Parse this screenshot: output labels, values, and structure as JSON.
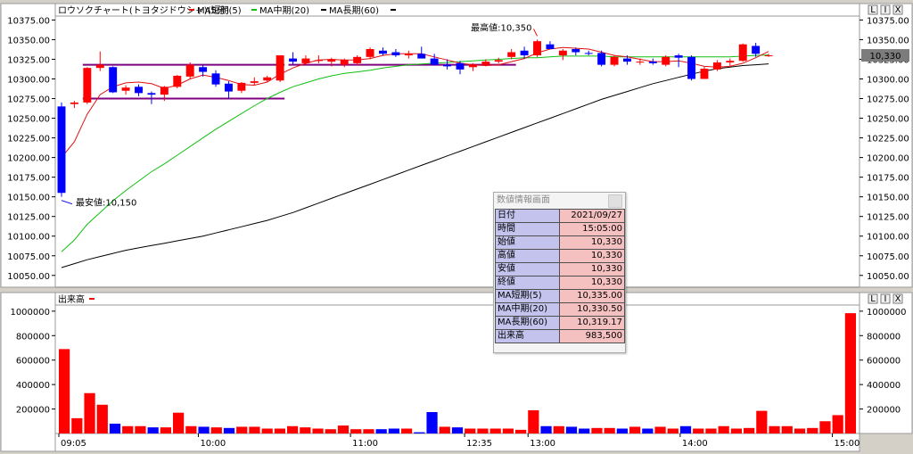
{
  "chart_data": [
    {
      "type": "candlestick",
      "title": "ロウソクチャート(トヨタジドウシャ)(5分)",
      "legend": [
        {
          "name": "MA短期(5)",
          "color": "#e01010"
        },
        {
          "name": "MA中期(20)",
          "color": "#10c010"
        },
        {
          "name": "MA長期(60)",
          "color": "#000000"
        }
      ],
      "ylim": [
        10035,
        10380
      ],
      "yticks": [
        10050,
        10075,
        10100,
        10125,
        10150,
        10175,
        10200,
        10225,
        10250,
        10275,
        10300,
        10325,
        10350,
        10375
      ],
      "ytick_labels": [
        "10050.00",
        "10075.00",
        "10100.00",
        "10125.00",
        "10150.00",
        "10175.00",
        "10200.00",
        "10225.00",
        "10250.00",
        "10275.00",
        "10300.00",
        "10325.00",
        "10350.00",
        "10375.00"
      ],
      "current_price_label": "10,330",
      "up_color": "#ff0000",
      "down_color": "#0000ff",
      "bars": [
        [
          10265,
          10270,
          10150,
          10155
        ],
        [
          10268,
          10272,
          10263,
          10270
        ],
        [
          10270,
          10315,
          10268,
          10314
        ],
        [
          10314,
          10335,
          10310,
          10318
        ],
        [
          10315,
          10316,
          10282,
          10283
        ],
        [
          10285,
          10292,
          10280,
          10289
        ],
        [
          10290,
          10293,
          10278,
          10282
        ],
        [
          10282,
          10284,
          10268,
          10280
        ],
        [
          10280,
          10291,
          10272,
          10290
        ],
        [
          10290,
          10305,
          10288,
          10304
        ],
        [
          10303,
          10321,
          10300,
          10318
        ],
        [
          10315,
          10318,
          10303,
          10309
        ],
        [
          10307,
          10311,
          10290,
          10293
        ],
        [
          10294,
          10297,
          10275,
          10284
        ],
        [
          10285,
          10296,
          10282,
          10295
        ],
        [
          10295,
          10302,
          10292,
          10297
        ],
        [
          10298,
          10304,
          10296,
          10302
        ],
        [
          10298,
          10320,
          10296,
          10330
        ],
        [
          10326,
          10334,
          10318,
          10322
        ],
        [
          10320,
          10330,
          10318,
          10326
        ],
        [
          10323,
          10330,
          10320,
          10324
        ],
        [
          10322,
          10327,
          10316,
          10325
        ],
        [
          10318,
          10326,
          10315,
          10324
        ],
        [
          10320,
          10330,
          10317,
          10328
        ],
        [
          10328,
          10340,
          10325,
          10338
        ],
        [
          10336,
          10340,
          10330,
          10332
        ],
        [
          10334,
          10338,
          10328,
          10330
        ],
        [
          10330,
          10336,
          10326,
          10332
        ],
        [
          10332,
          10341,
          10330,
          10326
        ],
        [
          10326,
          10332,
          10317,
          10318
        ],
        [
          10318,
          10325,
          10312,
          10316
        ],
        [
          10320,
          10323,
          10306,
          10312
        ],
        [
          10315,
          10320,
          10310,
          10318
        ],
        [
          10318,
          10325,
          10316,
          10322
        ],
        [
          10322,
          10327,
          10320,
          10324
        ],
        [
          10328,
          10338,
          10325,
          10334
        ],
        [
          10336,
          10341,
          10326,
          10330
        ],
        [
          10330,
          10350,
          10328,
          10348
        ],
        [
          10344,
          10348,
          10338,
          10338
        ],
        [
          10330,
          10338,
          10324,
          10336
        ],
        [
          10338,
          10340,
          10330,
          10334
        ],
        [
          10333,
          10336,
          10330,
          10332
        ],
        [
          10333,
          10336,
          10316,
          10318
        ],
        [
          10318,
          10330,
          10316,
          10328
        ],
        [
          10326,
          10330,
          10318,
          10322
        ],
        [
          10321,
          10326,
          10318,
          10322
        ],
        [
          10322,
          10326,
          10318,
          10320
        ],
        [
          10318,
          10330,
          10316,
          10328
        ],
        [
          10330,
          10332,
          10315,
          10327
        ],
        [
          10328,
          10330,
          10298,
          10300
        ],
        [
          10300,
          10316,
          10300,
          10313
        ],
        [
          10312,
          10324,
          10310,
          10321
        ],
        [
          10321,
          10326,
          10316,
          10323
        ],
        [
          10323,
          10345,
          10322,
          10344
        ],
        [
          10342,
          10346,
          10328,
          10332
        ],
        [
          10330,
          10332,
          10328,
          10330
        ]
      ],
      "ma_short": [
        10200,
        10220,
        10255,
        10280,
        10290,
        10295,
        10296,
        10294,
        10288,
        10292,
        10300,
        10305,
        10302,
        10298,
        10293,
        10292,
        10296,
        10306,
        10314,
        10320,
        10324,
        10325,
        10324,
        10324,
        10326,
        10330,
        10332,
        10332,
        10332,
        10328,
        10324,
        10320,
        10318,
        10317,
        10318,
        10322,
        10326,
        10333,
        10338,
        10340,
        10339,
        10338,
        10334,
        10330,
        10328,
        10325,
        10322,
        10322,
        10323,
        10320,
        10316,
        10315,
        10316,
        10320,
        10327,
        10335
      ],
      "ma_mid": [
        10080,
        10095,
        10115,
        10130,
        10145,
        10158,
        10170,
        10182,
        10192,
        10203,
        10214,
        10225,
        10236,
        10246,
        10256,
        10266,
        10275,
        10283,
        10290,
        10295,
        10300,
        10304,
        10307,
        10309,
        10311,
        10314,
        10316,
        10318,
        10319,
        10320,
        10321,
        10322,
        10323,
        10324,
        10325,
        10326,
        10327,
        10327,
        10328,
        10329,
        10329,
        10329,
        10329,
        10328,
        10328,
        10328,
        10328,
        10328,
        10328,
        10328,
        10328,
        10328,
        10328,
        10329,
        10330,
        10330.5
      ],
      "ma_long": [
        10060,
        10065,
        10070,
        10074,
        10078,
        10082,
        10085,
        10088,
        10091,
        10094,
        10097,
        10100,
        10104,
        10108,
        10112,
        10116,
        10120,
        10125,
        10130,
        10136,
        10142,
        10148,
        10154,
        10160,
        10166,
        10172,
        10178,
        10184,
        10190,
        10196,
        10202,
        10208,
        10214,
        10220,
        10226,
        10232,
        10238,
        10244,
        10250,
        10256,
        10262,
        10268,
        10274,
        10279,
        10284,
        10289,
        10294,
        10298,
        10302,
        10306,
        10310,
        10313,
        10315,
        10317,
        10318,
        10319.17
      ],
      "annotations": [
        {
          "text": "最高値:10,350",
          "bar": 37,
          "price": 10350,
          "color": "#ff0000"
        },
        {
          "text": "最安値:10,150",
          "bar": 0,
          "price": 10150,
          "color": "#0000ff"
        }
      ],
      "support_lines": [
        {
          "from": 2,
          "to": 17,
          "price": 10318,
          "color": "#800080"
        },
        {
          "from": 2,
          "to": 17,
          "price": 10275,
          "color": "#800080"
        },
        {
          "from": 18,
          "to": 35,
          "price": 10318,
          "color": "#800080"
        }
      ]
    },
    {
      "type": "bar",
      "title": "出来高",
      "ylim": [
        0,
        1050000
      ],
      "yticks": [
        200000,
        400000,
        600000,
        800000,
        1000000
      ],
      "ytick_labels": [
        "200000",
        "400000",
        "600000",
        "800000",
        "1000000"
      ],
      "x_labels": [
        {
          "bar": 0,
          "label": "09:05"
        },
        {
          "bar": 11,
          "label": "10:00"
        },
        {
          "bar": 23,
          "label": "11:00"
        },
        {
          "bar": 32,
          "label": "12:35"
        },
        {
          "bar": 37,
          "label": "13:00"
        },
        {
          "bar": 49,
          "label": "14:00"
        },
        {
          "bar": 61,
          "label": "15:00"
        }
      ],
      "volumes": [
        690000,
        125000,
        330000,
        235000,
        80000,
        60000,
        60000,
        50000,
        50000,
        170000,
        60000,
        55000,
        50000,
        45000,
        55000,
        55000,
        40000,
        40000,
        60000,
        50000,
        40000,
        35000,
        65000,
        35000,
        35000,
        35000,
        40000,
        40000,
        10000,
        175000,
        55000,
        50000,
        40000,
        40000,
        40000,
        40000,
        30000,
        190000,
        60000,
        60000,
        55000,
        40000,
        45000,
        45000,
        40000,
        55000,
        40000,
        55000,
        40000,
        60000,
        40000,
        40000,
        60000,
        40000,
        45000,
        185000,
        60000,
        60000,
        40000,
        45000,
        100000,
        150000,
        983500
      ]
    }
  ],
  "info_panel": {
    "title": "数値情報画面",
    "rows": [
      {
        "label": "日付",
        "value": "2021/09/27"
      },
      {
        "label": "時間",
        "value": "15:05:00"
      },
      {
        "label": "始値",
        "value": "10,330"
      },
      {
        "label": "高値",
        "value": "10,330"
      },
      {
        "label": "安値",
        "value": "10,330"
      },
      {
        "label": "終値",
        "value": "10,330"
      },
      {
        "label": "MA短期(5)",
        "value": "10,335.00"
      },
      {
        "label": "MA中期(20)",
        "value": "10,330.50"
      },
      {
        "label": "MA長期(60)",
        "value": "10,319.17"
      },
      {
        "label": "出来高",
        "value": "983,500"
      }
    ]
  }
}
